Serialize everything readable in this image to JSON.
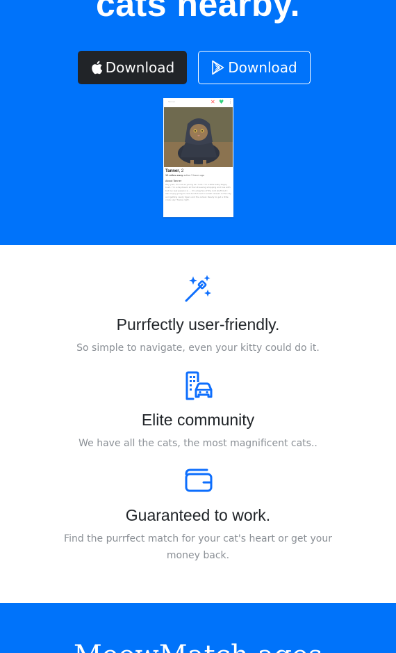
{
  "hero": {
    "title": "cats nearby.",
    "background_color": "#0073fa",
    "buttons": [
      {
        "label": "Download",
        "icon": "apple-icon",
        "style": "dark"
      },
      {
        "label": "Download",
        "icon": "google-play-icon",
        "style": "outline"
      }
    ]
  },
  "phone": {
    "top_label": "Tanner",
    "profile_name": "Tanner",
    "profile_age": ", 2",
    "distance": "12 miles away",
    "active": "active 3 hours ago",
    "about_title": "About Tanner",
    "about_text": "Hey y'all, I'm not as young as I look. I'm a little baby floppy bush. I'm a daydream at the UK seeing shopping and bus with but my real passion is ... I'm a big fan of the lord stuff, but I also enjoy going to new fun fish and in small venues in the city and getting ready tigers and the cutest. Ready to get a little crazy say? Swipe right."
  },
  "features": [
    {
      "icon": "magic-wand-icon",
      "title": "Purrfectly user-friendly.",
      "text": "So simple to navigate, even your kitty could do it."
    },
    {
      "icon": "building-car-icon",
      "title": "Elite community",
      "text": "We have all the cats, the most magnificent cats.."
    },
    {
      "icon": "wallet-icon",
      "title": "Guaranteed to work.",
      "text": "Find the purrfect match for your cat's heart or get your money back."
    }
  ],
  "footer": {
    "title": "MeowMatch ages"
  },
  "colors": {
    "accent": "#0073fa",
    "dark_button": "#212428",
    "title_text": "#212529",
    "muted_text": "#8a8f95"
  }
}
